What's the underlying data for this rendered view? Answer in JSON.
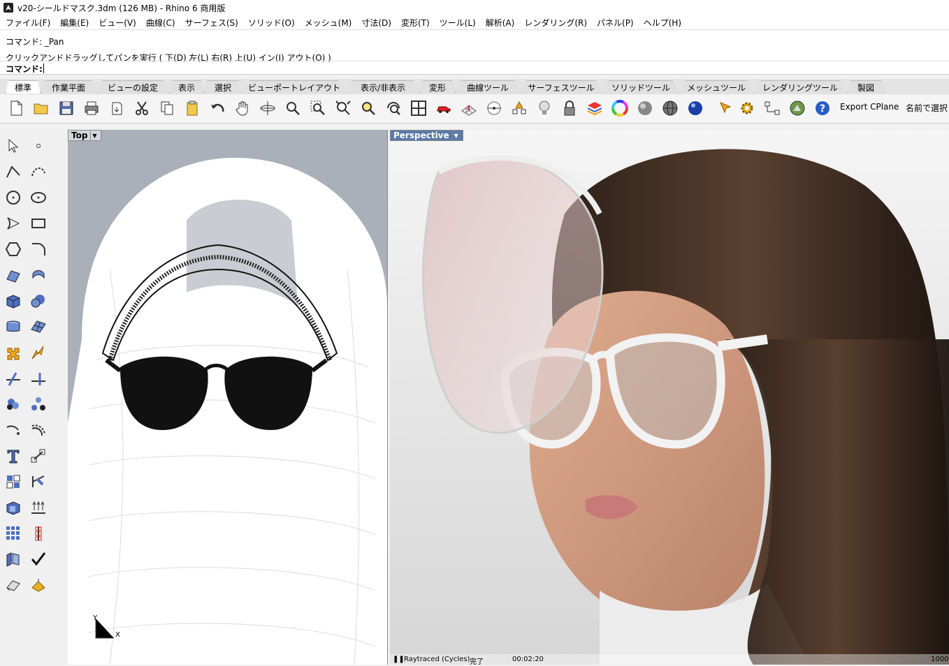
{
  "window": {
    "title": "v20-シールドマスク.3dm (126 MB) - Rhino 6 商用版"
  },
  "menu": [
    "ファイル(F)",
    "編集(E)",
    "ビュー(V)",
    "曲線(C)",
    "サーフェス(S)",
    "ソリッド(O)",
    "メッシュ(M)",
    "寸法(D)",
    "変形(T)",
    "ツール(L)",
    "解析(A)",
    "レンダリング(R)",
    "パネル(P)",
    "ヘルプ(H)"
  ],
  "command": {
    "history_line1": "コマンド: _Pan",
    "history_line2": "クリックアンドドラッグしてパンを実行 ( 下(D)  左(L)  右(R)  上(U)  イン(I)  アウト(O) )",
    "prompt_label": "コマンド:"
  },
  "tabs": [
    "標準",
    "作業平面",
    "ビューの設定",
    "表示",
    "選択",
    "ビューポートレイアウト",
    "表示/非表示",
    "変形",
    "曲線ツール",
    "サーフェスツール",
    "ソリッドツール",
    "メッシュツール",
    "レンダリングツール",
    "製図"
  ],
  "active_tab": 0,
  "toolbar": {
    "icons": [
      "new-file-icon",
      "open-folder-icon",
      "save-icon",
      "print-icon",
      "import-icon",
      "cut-icon",
      "copy-icon",
      "paste-icon",
      "undo-icon",
      "pan-hand-icon",
      "rotate-view-icon",
      "zoom-icon",
      "zoom-window-icon",
      "zoom-extents-icon",
      "zoom-selected-icon",
      "zoom-dynamic-icon",
      "four-viewports-icon",
      "car-icon",
      "grid-icon",
      "object-snap-icon",
      "points-icon",
      "light-icon",
      "lock-icon",
      "layers-icon",
      "color-wheel-icon",
      "shaded-sphere-icon",
      "wireframe-sphere-icon",
      "render-sphere-icon",
      "spotlight-icon",
      "options-gear-icon",
      "history-icon",
      "rhino-logo-icon",
      "help-icon"
    ],
    "export_cplane": "Export CPlane",
    "named_select": "名前で選択"
  },
  "viewports": {
    "top": {
      "label": "Top",
      "axis_x": "X",
      "axis_y": "Y"
    },
    "perspective": {
      "label": "Perspective"
    }
  },
  "status": {
    "mode": "Raytraced (Cycles)",
    "state": "完了",
    "time": "00:02:20",
    "samples": "1000"
  },
  "colors": {
    "accent": "#5b7aa8",
    "viewport_label_bg": "#d2d7de"
  }
}
